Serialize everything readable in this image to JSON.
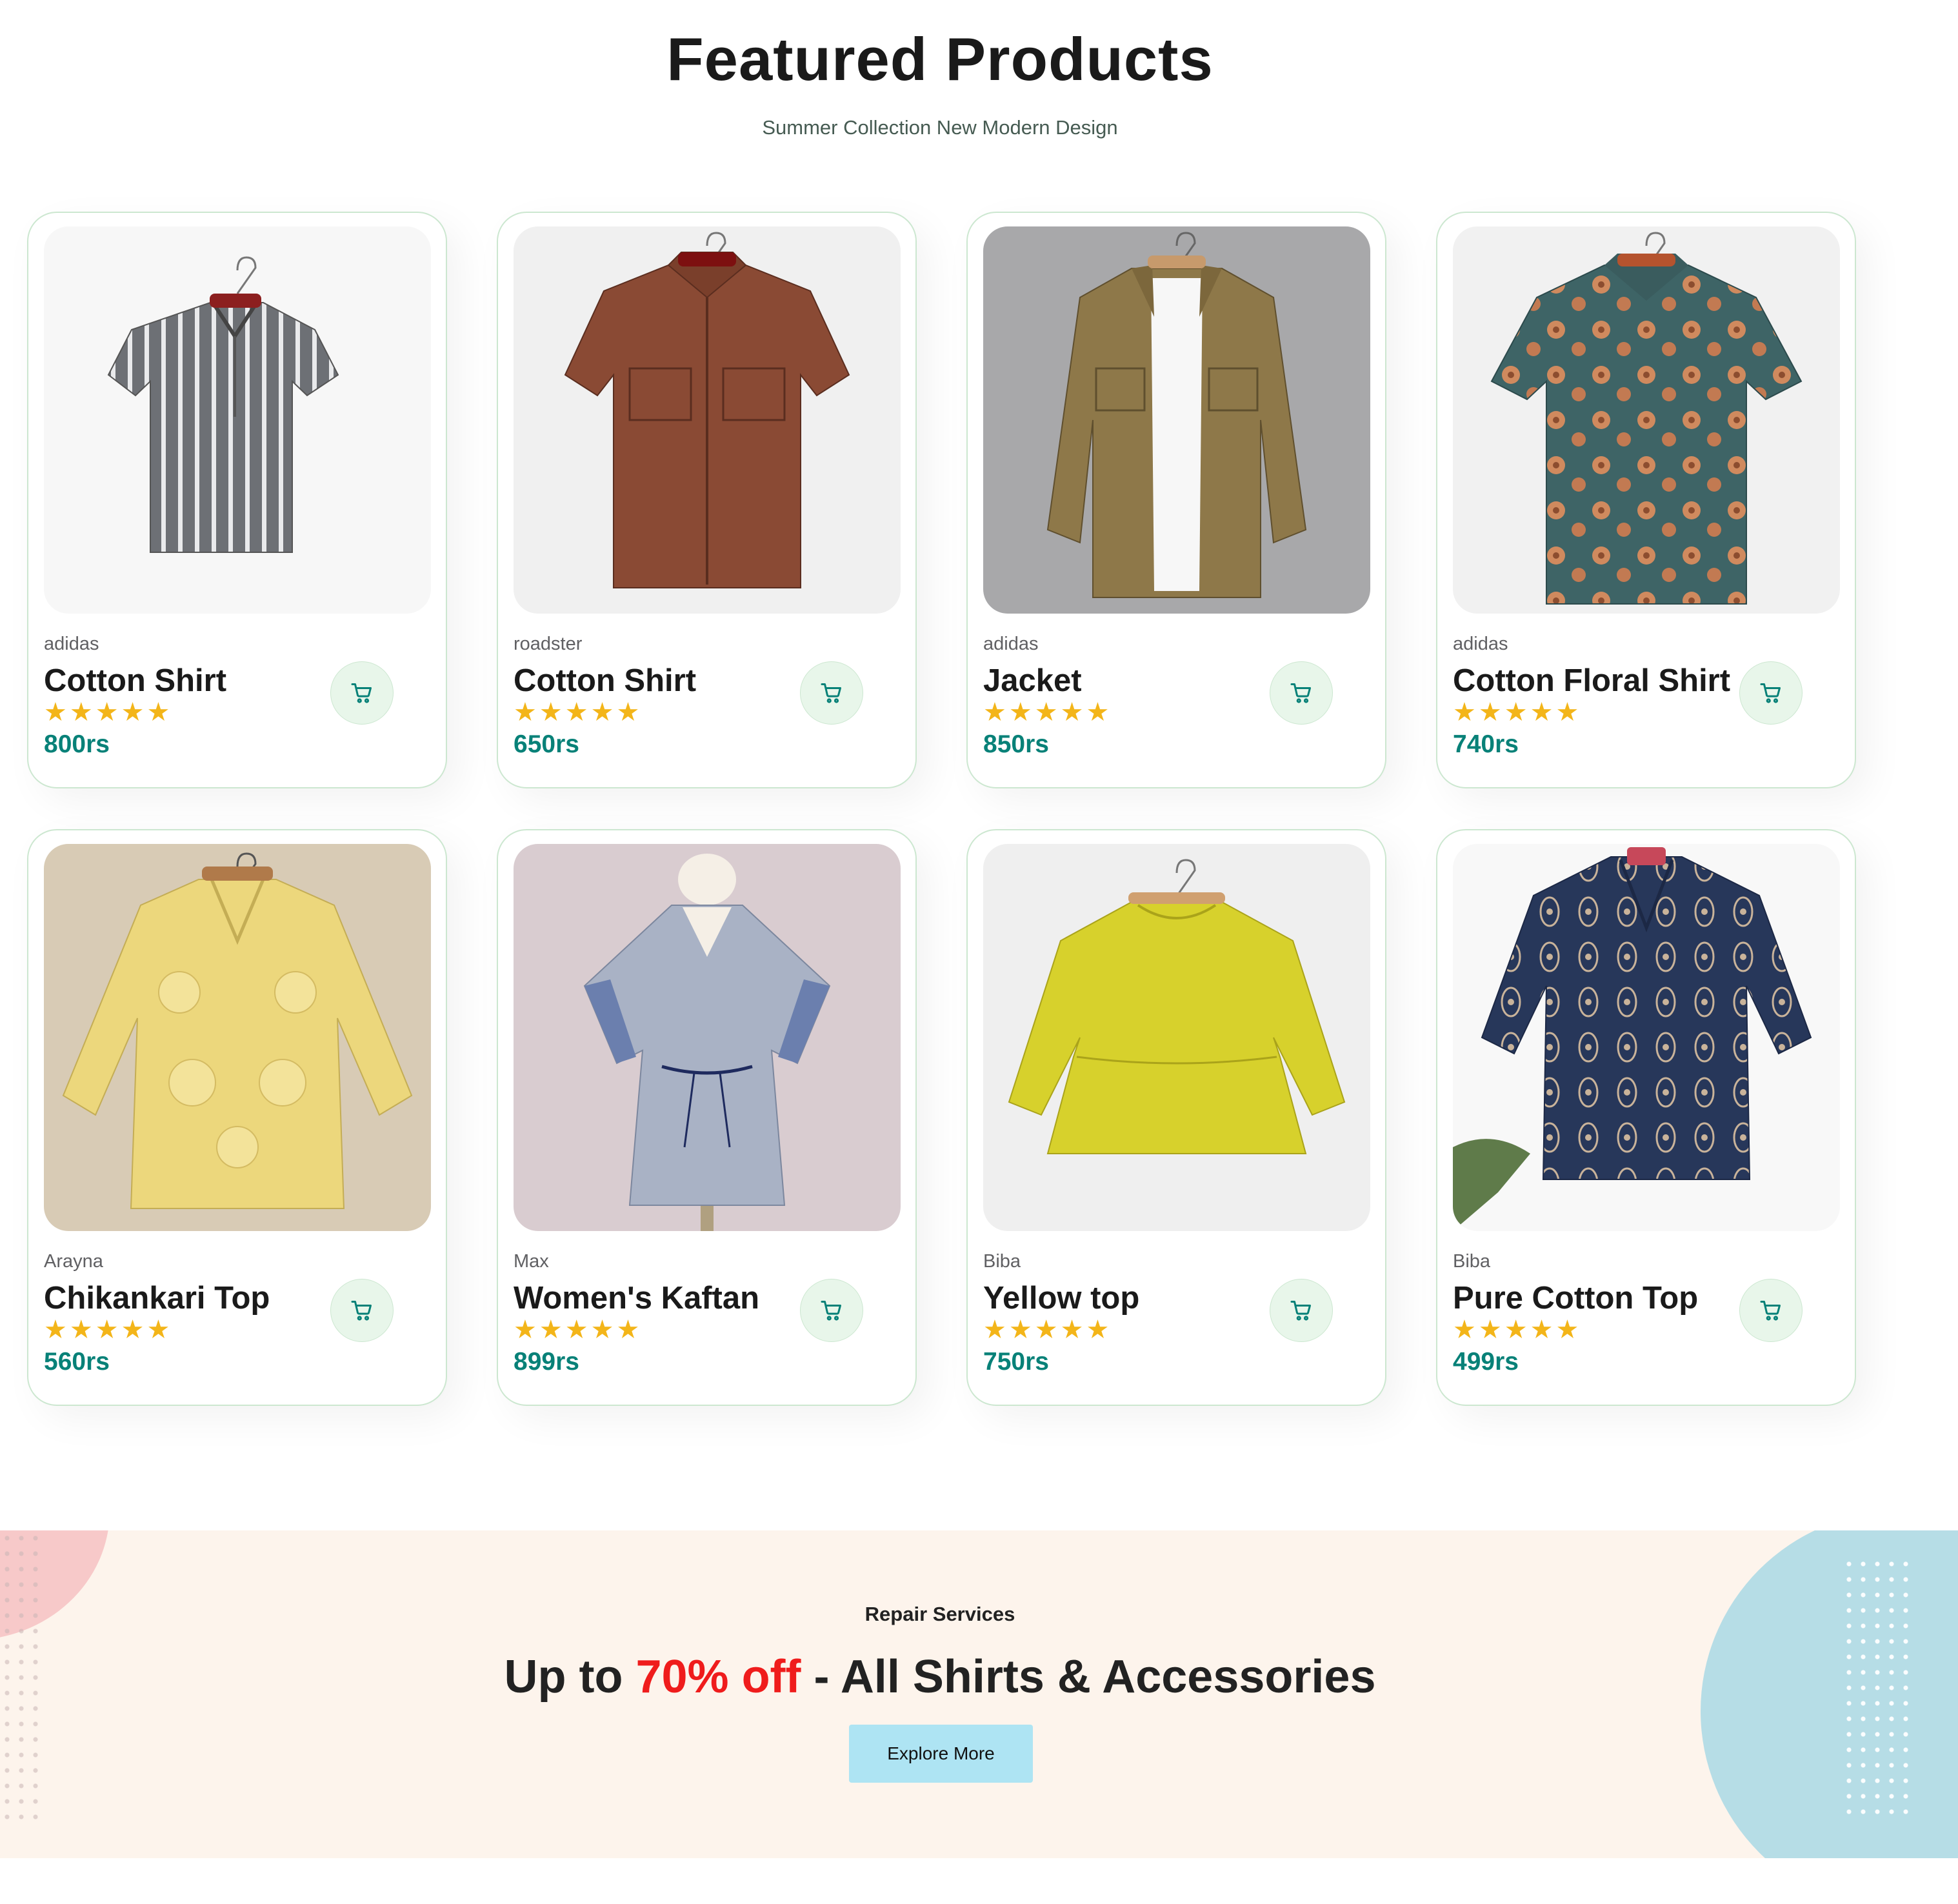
{
  "header": {
    "title": "Featured Products",
    "subtitle": "Summer Collection New Modern Design"
  },
  "products": [
    {
      "brand": "adidas",
      "name": "Cotton Shirt",
      "rating": 5,
      "stars": "★★★★★",
      "price": "800rs",
      "image_icon": "gray-striped-shirt"
    },
    {
      "brand": "roadster",
      "name": "Cotton Shirt",
      "rating": 5,
      "stars": "★★★★★",
      "price": "650rs",
      "image_icon": "brown-shirt"
    },
    {
      "brand": "adidas",
      "name": "Jacket",
      "rating": 5,
      "stars": "★★★★★",
      "price": "850rs",
      "image_icon": "khaki-jacket"
    },
    {
      "brand": "adidas",
      "name": "Cotton Floral Shirt",
      "rating": 5,
      "stars": "★★★★★",
      "price": "740rs",
      "image_icon": "teal-floral-shirt"
    },
    {
      "brand": "Arayna",
      "name": "Chikankari Top",
      "rating": 5,
      "stars": "★★★★★",
      "price": "560rs",
      "image_icon": "yellow-chikankari-top"
    },
    {
      "brand": "Max",
      "name": "Women's Kaftan",
      "rating": 5,
      "stars": "★★★★★",
      "price": "899rs",
      "image_icon": "blue-kaftan"
    },
    {
      "brand": "Biba",
      "name": "Yellow top",
      "rating": 5,
      "stars": "★★★★★",
      "price": "750rs",
      "image_icon": "yellow-peplum-top"
    },
    {
      "brand": "Biba",
      "name": "Pure Cotton Top",
      "rating": 5,
      "stars": "★★★★★",
      "price": "499rs",
      "image_icon": "navy-print-top"
    }
  ],
  "banner": {
    "eyebrow": "Repair Services",
    "headline_before": "Up to ",
    "headline_highlight": "70% off",
    "headline_after": " - All Shirts & Accessories",
    "button_label": "Explore More"
  },
  "colors": {
    "accent": "#088178",
    "star": "#f3b519",
    "card_border": "#cce7d0",
    "cart_bg": "#e8f6ea",
    "banner_bg": "#fdf4ec",
    "highlight_red": "#ef1c1c",
    "button_bg": "#aee4f3"
  }
}
